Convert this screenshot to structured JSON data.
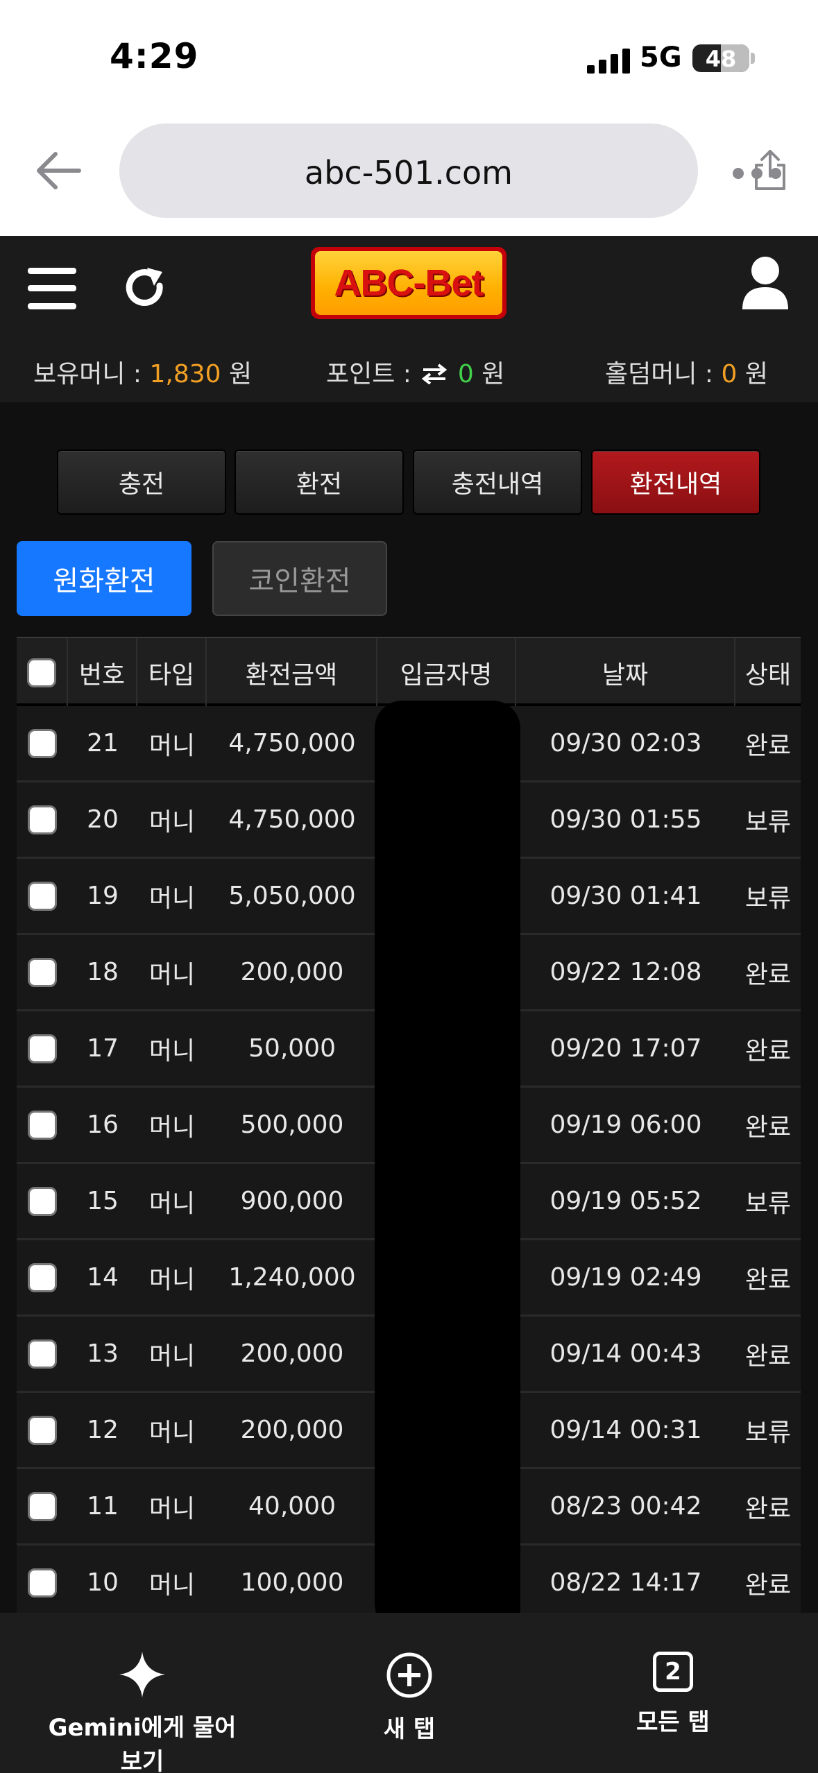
{
  "status_bar": {
    "time": "4:29",
    "network": "5G",
    "battery": "48"
  },
  "browser": {
    "url": "abc-501.com"
  },
  "site": {
    "logo": "ABC-Bet",
    "balance": {
      "label": "보유머니 :",
      "value": "1,830",
      "unit": "원"
    },
    "points": {
      "label": "포인트 :",
      "value": "0",
      "unit": "원"
    },
    "holdem": {
      "label": "홀덤머니 :",
      "value": "0",
      "unit": "원"
    }
  },
  "tabs": [
    {
      "label": "충전"
    },
    {
      "label": "환전"
    },
    {
      "label": "충전내역"
    },
    {
      "label": "환전내역",
      "active": true
    }
  ],
  "subtabs": [
    {
      "label": "원화환전",
      "active": true
    },
    {
      "label": "코인환전"
    }
  ],
  "table": {
    "headers": [
      "번호",
      "타입",
      "환전금액",
      "입금자명",
      "날짜",
      "상태"
    ],
    "rows": [
      {
        "no": "21",
        "type": "머니",
        "amount": "4,750,000",
        "name": "",
        "date": "09/30 02:03",
        "status": "완료"
      },
      {
        "no": "20",
        "type": "머니",
        "amount": "4,750,000",
        "name": "",
        "date": "09/30 01:55",
        "status": "보류"
      },
      {
        "no": "19",
        "type": "머니",
        "amount": "5,050,000",
        "name": "",
        "date": "09/30 01:41",
        "status": "보류"
      },
      {
        "no": "18",
        "type": "머니",
        "amount": "200,000",
        "name": "",
        "date": "09/22 12:08",
        "status": "완료"
      },
      {
        "no": "17",
        "type": "머니",
        "amount": "50,000",
        "name": "",
        "date": "09/20 17:07",
        "status": "완료"
      },
      {
        "no": "16",
        "type": "머니",
        "amount": "500,000",
        "name": "",
        "date": "09/19 06:00",
        "status": "완료"
      },
      {
        "no": "15",
        "type": "머니",
        "amount": "900,000",
        "name": "",
        "date": "09/19 05:52",
        "status": "보류"
      },
      {
        "no": "14",
        "type": "머니",
        "amount": "1,240,000",
        "name": "",
        "date": "09/19 02:49",
        "status": "완료"
      },
      {
        "no": "13",
        "type": "머니",
        "amount": "200,000",
        "name": "",
        "date": "09/14 00:43",
        "status": "완료"
      },
      {
        "no": "12",
        "type": "머니",
        "amount": "200,000",
        "name": "",
        "date": "09/14 00:31",
        "status": "보류"
      },
      {
        "no": "11",
        "type": "머니",
        "amount": "40,000",
        "name": "",
        "date": "08/23 00:42",
        "status": "완료"
      },
      {
        "no": "10",
        "type": "머니",
        "amount": "100,000",
        "name": "",
        "date": "08/22 14:17",
        "status": "완료"
      }
    ]
  },
  "toolbar": {
    "gemini": "Gemini에게 물어보기",
    "new_tab": "새 탭",
    "all_tabs": "모든 탭",
    "tab_count": "2"
  },
  "colors": {
    "accent_blue": "#1677ff",
    "active_red": "#b2191d",
    "money_orange": "#f2a024",
    "point_green": "#41d14a"
  }
}
